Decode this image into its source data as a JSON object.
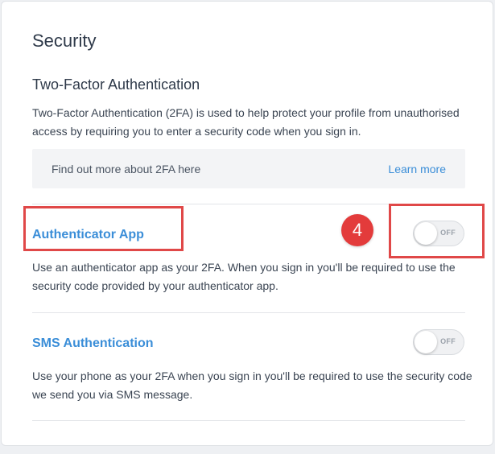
{
  "page": {
    "title": "Security"
  },
  "two_factor": {
    "title": "Two-Factor Authentication",
    "description": "Two-Factor Authentication (2FA) is used to help protect your profile from unauthorised access by requiring you to enter a security code when you sign in.",
    "info_text": "Find out more about 2FA here",
    "learn_more_label": "Learn more"
  },
  "options": [
    {
      "title": "Authenticator App",
      "description": "Use an authenticator app as your 2FA. When you sign in you'll be required to use the security code provided by your authenticator app.",
      "toggle_label": "OFF"
    },
    {
      "title": "SMS Authentication",
      "description": "Use your phone as your 2FA when you sign in you'll be required to use the security code we send you via SMS message.",
      "toggle_label": "OFF"
    }
  ],
  "annotation": {
    "step_number": "4",
    "color": "#e04848"
  },
  "colors": {
    "accent": "#3b8ed8",
    "text": "#2f3a4a"
  }
}
